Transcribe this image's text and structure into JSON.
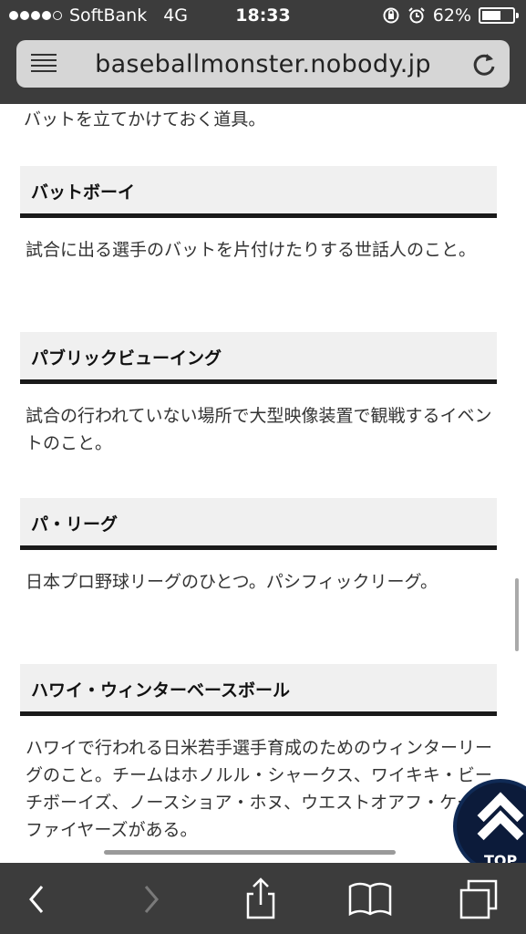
{
  "status_bar": {
    "carrier": "SoftBank",
    "network": "4G",
    "time": "18:33",
    "battery_percent": "62%",
    "battery_level": 0.62
  },
  "address_bar": {
    "url": "baseballmonster.nobody.jp"
  },
  "content": {
    "previous_description": "バットを立てかけておく道具。",
    "terms": [
      {
        "title": "バットボーイ",
        "description": "試合に出る選手のバットを片付けたりする世話人のこと。"
      },
      {
        "title": "パブリックビューイング",
        "description": "試合の行われていない場所で大型映像装置で観戦するイベントのこと。"
      },
      {
        "title": "パ・リーグ",
        "description": "日本プロ野球リーグのひとつ。パシフィックリーグ。"
      },
      {
        "title": "ハワイ・ウィンターベースボール",
        "description": "ハワイで行われる日米若手選手育成のためのウィンターリーグのこと。チームはホノルル・シャークス、ワイキキ・ビーチボーイズ、ノースショア・ホヌ、ウエストオアフ・ケーンファイヤーズがある。"
      }
    ]
  },
  "top_button": {
    "label": "TOP"
  },
  "bottom_toolbar": {
    "icons": [
      "back-icon",
      "forward-icon",
      "share-icon",
      "bookmarks-icon",
      "tabs-icon"
    ]
  }
}
